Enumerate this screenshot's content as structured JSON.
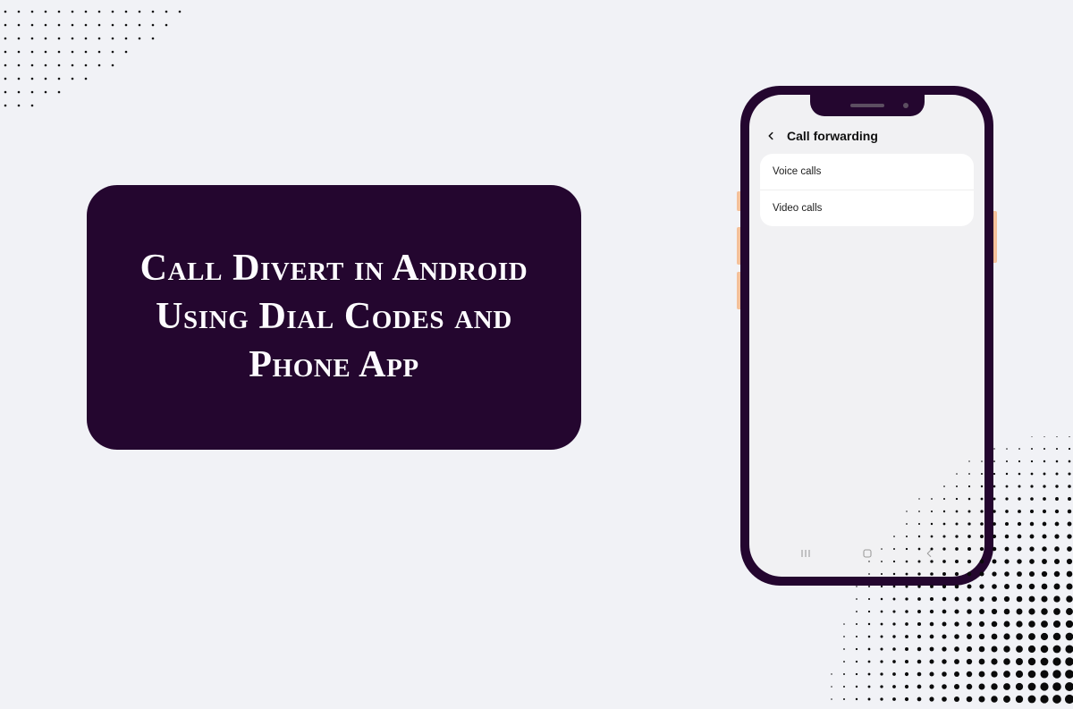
{
  "card": {
    "title": "Call Divert in Android Using Dial Codes and Phone App"
  },
  "phone": {
    "header_title": "Call forwarding",
    "items": [
      "Voice calls",
      "Video calls"
    ]
  },
  "colors": {
    "card_bg": "#24062f",
    "page_bg": "#f1f2f6"
  }
}
